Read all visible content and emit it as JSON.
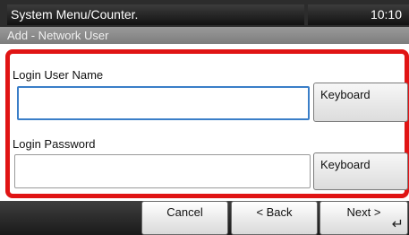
{
  "status": {
    "menu_title": "System Menu/Counter.",
    "time": "10:10"
  },
  "screen": {
    "title": "Add - Network User"
  },
  "form": {
    "username_label": "Login User Name",
    "username_value": "",
    "password_label": "Login Password",
    "password_value": "",
    "keyboard_label": "Keyboard"
  },
  "nav": {
    "cancel_label": "Cancel",
    "back_label": "< Back",
    "next_label": "Next >"
  },
  "icons": {
    "enter": "enter-icon"
  },
  "colors": {
    "highlight_border": "#e01414",
    "focus_border": "#3a7ec8"
  }
}
